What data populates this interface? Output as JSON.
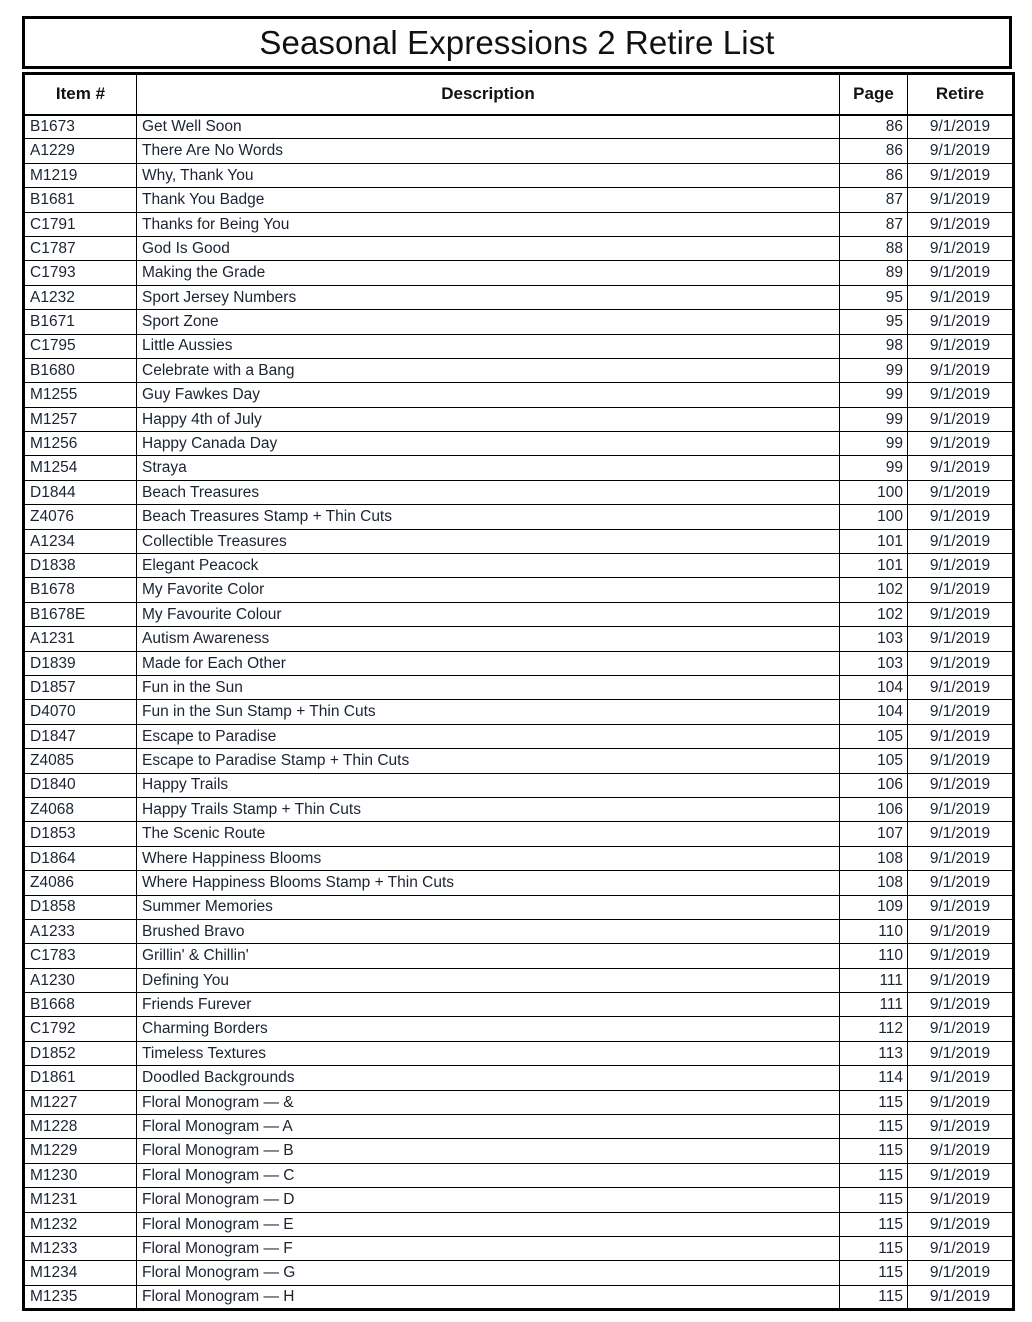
{
  "document": {
    "title": "Seasonal Expressions 2 Retire List"
  },
  "table": {
    "columns": [
      {
        "key": "item",
        "label": "Item #"
      },
      {
        "key": "desc",
        "label": "Description"
      },
      {
        "key": "page",
        "label": "Page"
      },
      {
        "key": "retire",
        "label": "Retire"
      }
    ],
    "rows": [
      {
        "item": "B1673",
        "desc": "Get Well Soon",
        "page": "86",
        "retire": "9/1/2019"
      },
      {
        "item": "A1229",
        "desc": "There Are No Words",
        "page": "86",
        "retire": "9/1/2019"
      },
      {
        "item": "M1219",
        "desc": "Why, Thank You",
        "page": "86",
        "retire": "9/1/2019"
      },
      {
        "item": "B1681",
        "desc": "Thank You Badge",
        "page": "87",
        "retire": "9/1/2019"
      },
      {
        "item": "C1791",
        "desc": "Thanks for Being You",
        "page": "87",
        "retire": "9/1/2019"
      },
      {
        "item": "C1787",
        "desc": "God Is Good",
        "page": "88",
        "retire": "9/1/2019"
      },
      {
        "item": "C1793",
        "desc": "Making the Grade",
        "page": "89",
        "retire": "9/1/2019"
      },
      {
        "item": "A1232",
        "desc": "Sport Jersey Numbers",
        "page": "95",
        "retire": "9/1/2019"
      },
      {
        "item": "B1671",
        "desc": "Sport Zone",
        "page": "95",
        "retire": "9/1/2019"
      },
      {
        "item": "C1795",
        "desc": "Little Aussies",
        "page": "98",
        "retire": "9/1/2019"
      },
      {
        "item": "B1680",
        "desc": "Celebrate with a Bang",
        "page": "99",
        "retire": "9/1/2019"
      },
      {
        "item": "M1255",
        "desc": "Guy Fawkes Day",
        "page": "99",
        "retire": "9/1/2019"
      },
      {
        "item": "M1257",
        "desc": "Happy 4th of July",
        "page": "99",
        "retire": "9/1/2019"
      },
      {
        "item": "M1256",
        "desc": "Happy Canada Day",
        "page": "99",
        "retire": "9/1/2019"
      },
      {
        "item": "M1254",
        "desc": "Straya",
        "page": "99",
        "retire": "9/1/2019"
      },
      {
        "item": "D1844",
        "desc": "Beach Treasures",
        "page": "100",
        "retire": "9/1/2019"
      },
      {
        "item": "Z4076",
        "desc": "Beach Treasures Stamp + Thin Cuts",
        "page": "100",
        "retire": "9/1/2019"
      },
      {
        "item": "A1234",
        "desc": "Collectible Treasures",
        "page": "101",
        "retire": "9/1/2019"
      },
      {
        "item": "D1838",
        "desc": "Elegant Peacock",
        "page": "101",
        "retire": "9/1/2019"
      },
      {
        "item": "B1678",
        "desc": "My Favorite Color",
        "page": "102",
        "retire": "9/1/2019"
      },
      {
        "item": "B1678E",
        "desc": "My Favourite Colour",
        "page": "102",
        "retire": "9/1/2019"
      },
      {
        "item": "A1231",
        "desc": "Autism Awareness",
        "page": "103",
        "retire": "9/1/2019"
      },
      {
        "item": "D1839",
        "desc": "Made for Each Other",
        "page": "103",
        "retire": "9/1/2019"
      },
      {
        "item": "D1857",
        "desc": "Fun in the Sun",
        "page": "104",
        "retire": "9/1/2019"
      },
      {
        "item": "D4070",
        "desc": "Fun in the Sun Stamp + Thin Cuts",
        "page": "104",
        "retire": "9/1/2019"
      },
      {
        "item": "D1847",
        "desc": "Escape to Paradise",
        "page": "105",
        "retire": "9/1/2019"
      },
      {
        "item": "Z4085",
        "desc": "Escape to Paradise Stamp + Thin Cuts",
        "page": "105",
        "retire": "9/1/2019"
      },
      {
        "item": "D1840",
        "desc": "Happy Trails",
        "page": "106",
        "retire": "9/1/2019"
      },
      {
        "item": "Z4068",
        "desc": "Happy Trails Stamp + Thin Cuts",
        "page": "106",
        "retire": "9/1/2019"
      },
      {
        "item": "D1853",
        "desc": "The Scenic Route",
        "page": "107",
        "retire": "9/1/2019"
      },
      {
        "item": "D1864",
        "desc": "Where Happiness Blooms",
        "page": "108",
        "retire": "9/1/2019"
      },
      {
        "item": "Z4086",
        "desc": "Where Happiness Blooms Stamp + Thin Cuts",
        "page": "108",
        "retire": "9/1/2019"
      },
      {
        "item": "D1858",
        "desc": "Summer Memories",
        "page": "109",
        "retire": "9/1/2019"
      },
      {
        "item": "A1233",
        "desc": "Brushed Bravo",
        "page": "110",
        "retire": "9/1/2019"
      },
      {
        "item": "C1783",
        "desc": "Grillin' & Chillin'",
        "page": "110",
        "retire": "9/1/2019"
      },
      {
        "item": "A1230",
        "desc": "Defining You",
        "page": "111",
        "retire": "9/1/2019"
      },
      {
        "item": "B1668",
        "desc": "Friends Furever",
        "page": "111",
        "retire": "9/1/2019"
      },
      {
        "item": "C1792",
        "desc": "Charming Borders",
        "page": "112",
        "retire": "9/1/2019"
      },
      {
        "item": "D1852",
        "desc": "Timeless Textures",
        "page": "113",
        "retire": "9/1/2019"
      },
      {
        "item": "D1861",
        "desc": "Doodled Backgrounds",
        "page": "114",
        "retire": "9/1/2019"
      },
      {
        "item": "M1227",
        "desc": "Floral Monogram — &",
        "page": "115",
        "retire": "9/1/2019"
      },
      {
        "item": "M1228",
        "desc": "Floral Monogram — A",
        "page": "115",
        "retire": "9/1/2019"
      },
      {
        "item": "M1229",
        "desc": "Floral Monogram — B",
        "page": "115",
        "retire": "9/1/2019"
      },
      {
        "item": "M1230",
        "desc": "Floral Monogram — C",
        "page": "115",
        "retire": "9/1/2019"
      },
      {
        "item": "M1231",
        "desc": "Floral Monogram — D",
        "page": "115",
        "retire": "9/1/2019"
      },
      {
        "item": "M1232",
        "desc": "Floral Monogram — E",
        "page": "115",
        "retire": "9/1/2019"
      },
      {
        "item": "M1233",
        "desc": "Floral Monogram — F",
        "page": "115",
        "retire": "9/1/2019"
      },
      {
        "item": "M1234",
        "desc": "Floral Monogram — G",
        "page": "115",
        "retire": "9/1/2019"
      },
      {
        "item": "M1235",
        "desc": "Floral Monogram — H",
        "page": "115",
        "retire": "9/1/2019"
      }
    ]
  },
  "colors": {
    "border": "#000000",
    "title_text": "#111111",
    "body_text": "#1b2433",
    "background": "#ffffff"
  }
}
